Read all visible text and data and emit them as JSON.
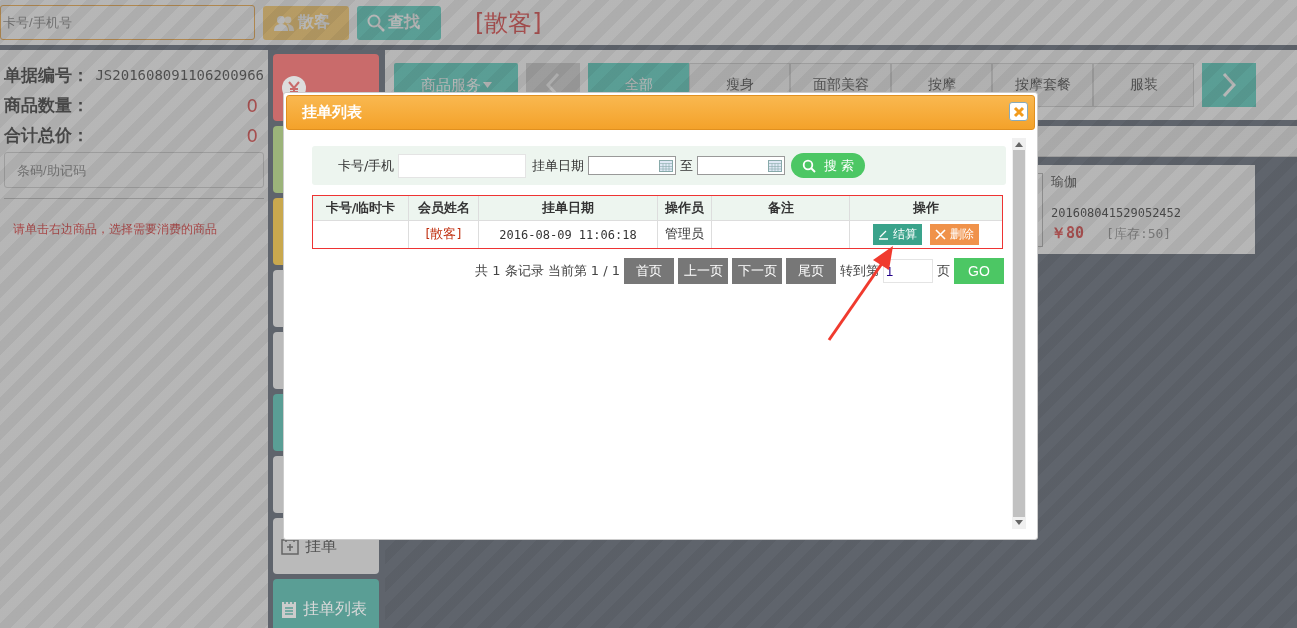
{
  "top_bar": {
    "card_field": {
      "placeholder": "卡号/手机号"
    },
    "buttons": [
      {
        "label": "散客",
        "kind": "walkin"
      },
      {
        "label": "查找",
        "kind": "search"
      }
    ],
    "customer": "[散客]"
  },
  "order_summary": {
    "rows": [
      {
        "label": "单据编号：",
        "value": "JS201608091106200966",
        "kind": "code"
      },
      {
        "label": "商品数量：",
        "value": "0",
        "kind": "number"
      },
      {
        "label": "合计总价：",
        "value": "0",
        "kind": "number"
      }
    ],
    "barcode_field": {
      "placeholder": "条码/助记码"
    },
    "hint": "请单击右边商品，选择需要消费的商品"
  },
  "side_buttons": [
    {
      "color": "#c96b6b",
      "kind": "checkout"
    },
    {
      "color": "#9cb47a",
      "kind": "plain"
    },
    {
      "color": "#c9a84e",
      "kind": "plain"
    },
    {
      "color": "#bababa",
      "kind": "plain"
    },
    {
      "color": "#bababa",
      "kind": "plain"
    },
    {
      "color": "#5a9e95",
      "kind": "plain"
    },
    {
      "color": "#bababa",
      "kind": "plain"
    },
    {
      "label": "挂单",
      "color": "#bababa",
      "kind": "hold"
    },
    {
      "label": "挂单列表",
      "color": "#5a9e95",
      "kind": "list"
    }
  ],
  "category_bar": {
    "dropdown": "商品服务",
    "tabs": [
      {
        "label": "全部",
        "selected": true
      },
      {
        "label": "瘦身",
        "selected": false
      },
      {
        "label": "面部美容",
        "selected": false
      },
      {
        "label": "按摩",
        "selected": false
      },
      {
        "label": "按摩套餐",
        "selected": false
      },
      {
        "label": "服装",
        "selected": false
      }
    ]
  },
  "products": [
    {
      "name": "瑜伽",
      "code": "201608041529052452",
      "price": "￥80",
      "stock": "[库存:50]"
    }
  ],
  "dialog": {
    "title": "挂单列表",
    "search": {
      "card_label": "卡号/手机",
      "date_label": "挂单日期",
      "to_label": "至",
      "button": "搜 索"
    },
    "table": {
      "columns": [
        "卡号/临时卡",
        "会员姓名",
        "挂单日期",
        "操作员",
        "备注",
        "操作"
      ],
      "rows": [
        {
          "member": "[散客]",
          "date": "2016-08-09 11:06:18",
          "operator": "管理员",
          "actions": [
            {
              "label": "结算",
              "kind": "settle"
            },
            {
              "label": "删除",
              "kind": "delete"
            }
          ]
        }
      ]
    },
    "pagination": {
      "summary": "共 1 条记录 当前第 1 / 1",
      "buttons": [
        "首页",
        "上一页",
        "下一页",
        "尾页"
      ],
      "goto_label": "转到第",
      "page_value": "1",
      "page_suffix": "页",
      "go": "GO"
    }
  }
}
